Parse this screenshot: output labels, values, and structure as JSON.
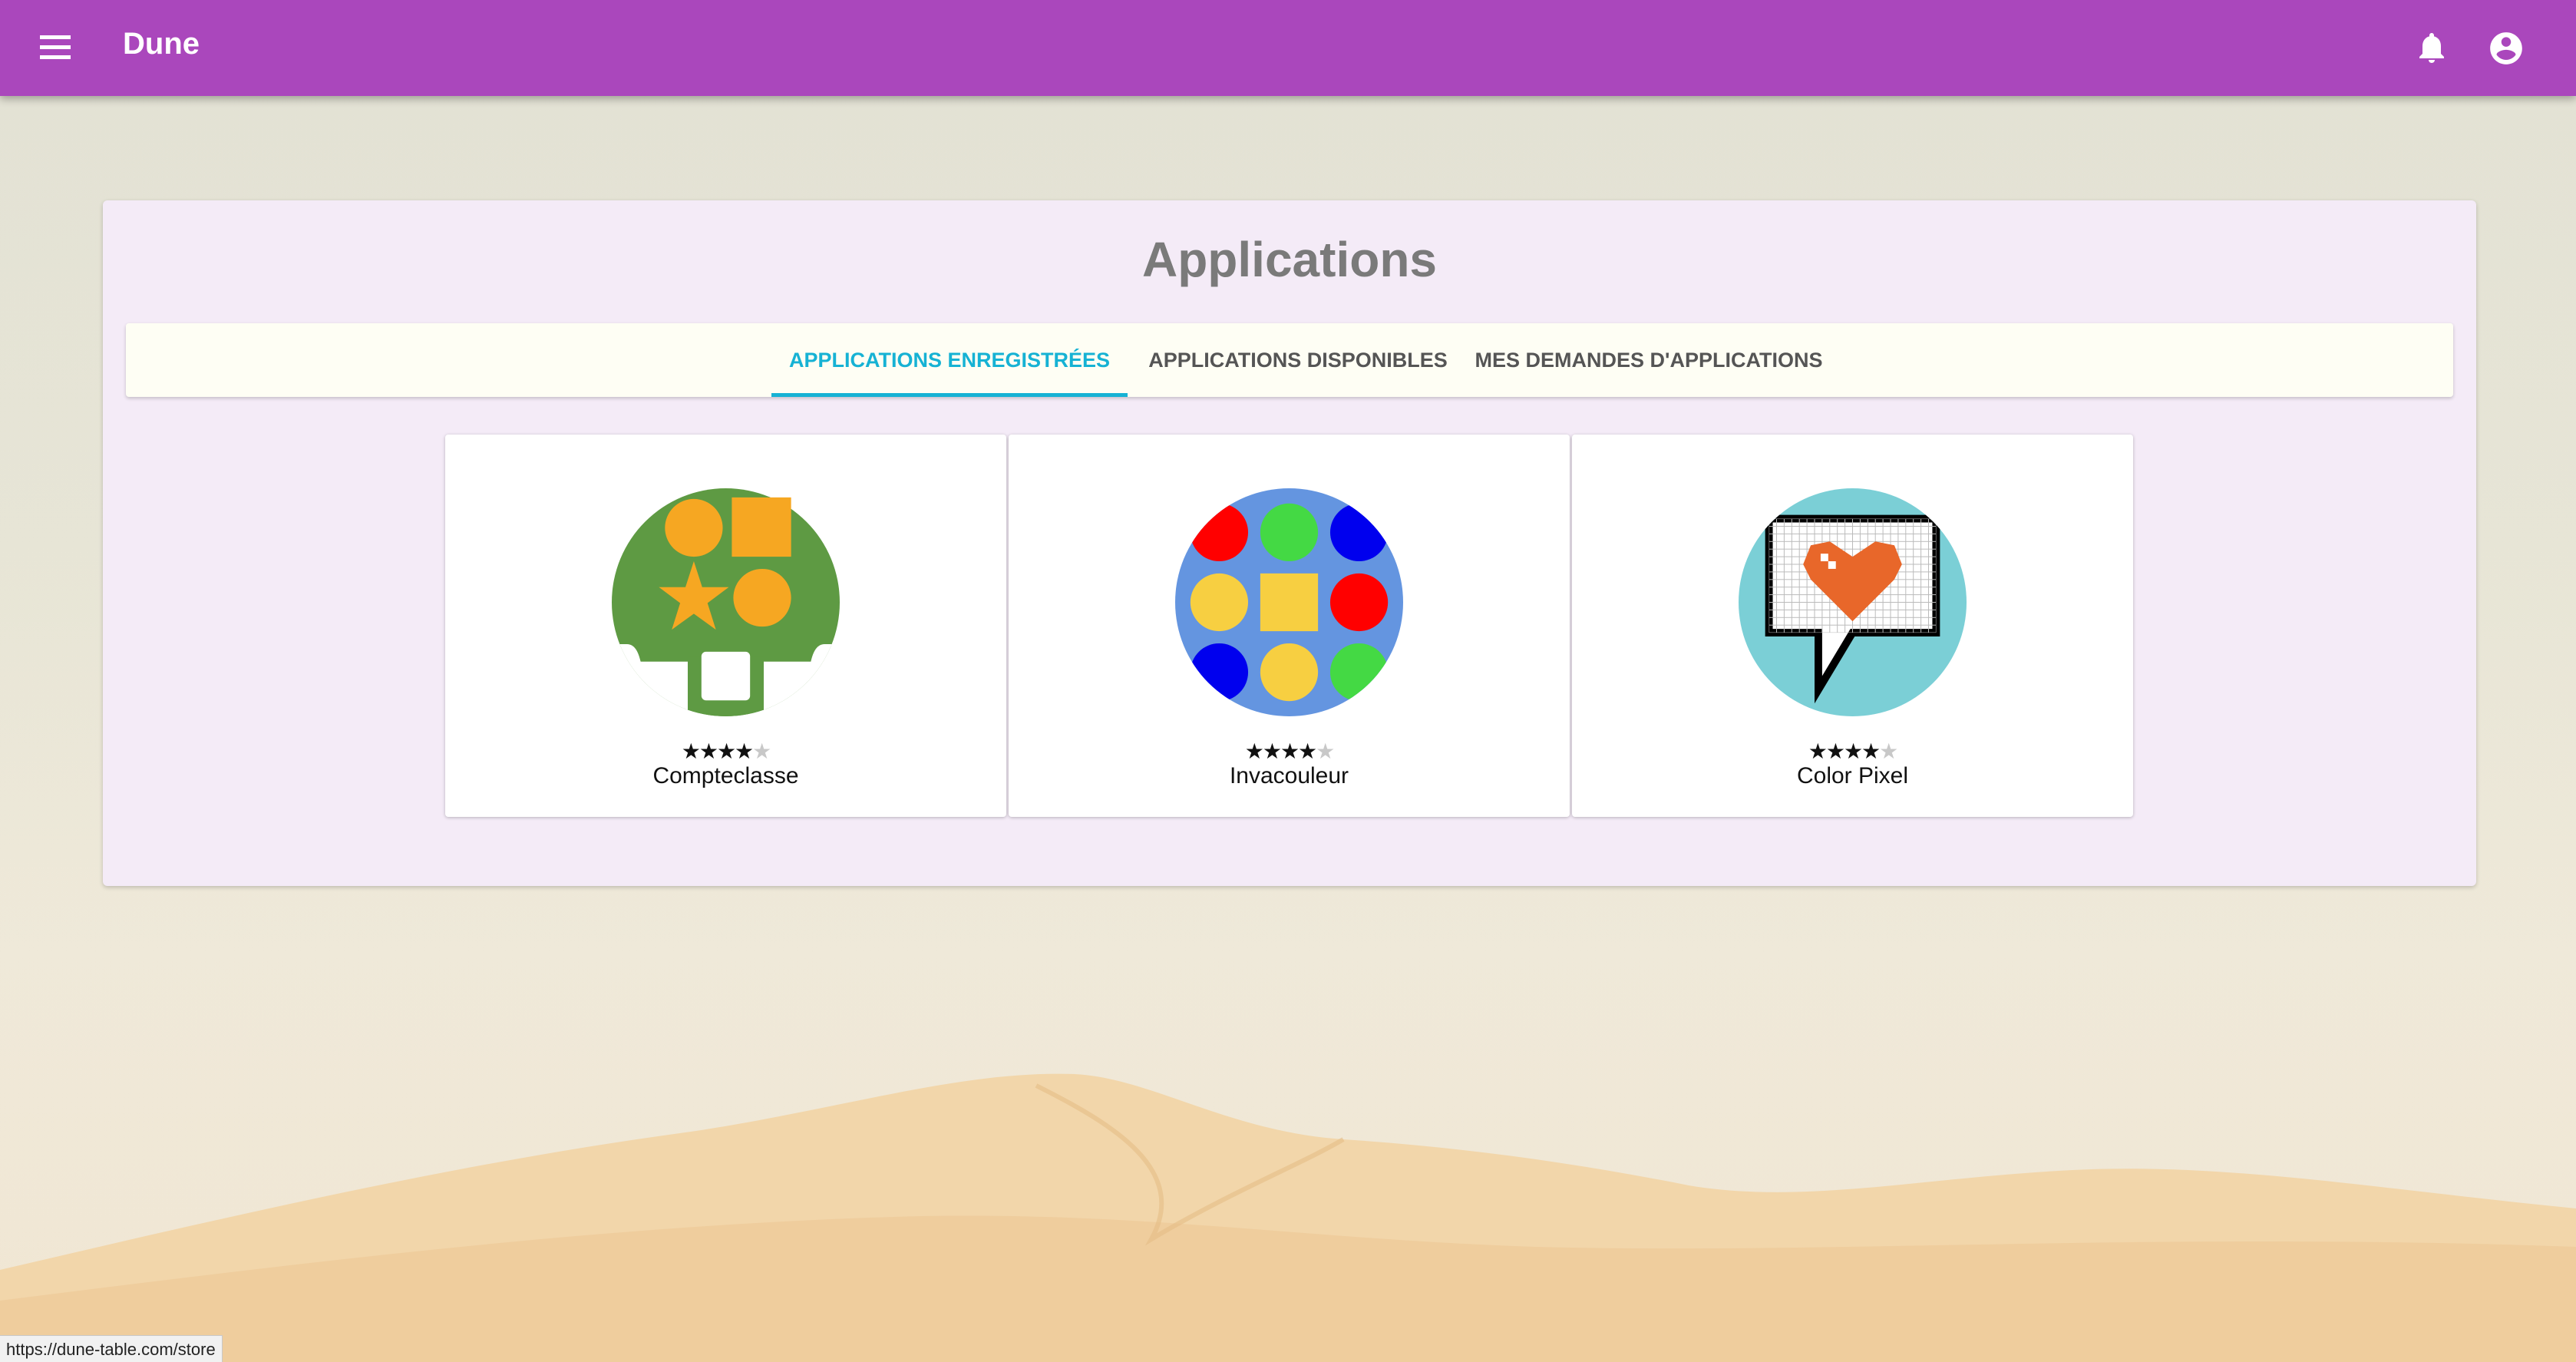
{
  "appbar": {
    "title": "Dune",
    "menu_icon": "menu-icon",
    "notification_icon": "bell-icon",
    "account_icon": "account-circle-icon",
    "color": "#aa47bc"
  },
  "page": {
    "title": "Applications"
  },
  "tabs": [
    {
      "label": "APPLICATIONS ENREGISTRÉES",
      "active": true
    },
    {
      "label": "APPLICATIONS DISPONIBLES",
      "active": false
    },
    {
      "label": "MES DEMANDES D'APPLICATIONS",
      "active": false
    }
  ],
  "apps": [
    {
      "name": "Compteclasse",
      "rating": 4,
      "rating_max": 5,
      "logo_icon": "compteclasse-logo-icon"
    },
    {
      "name": "Invacouleur",
      "rating": 4,
      "rating_max": 5,
      "logo_icon": "invacouleur-logo-icon"
    },
    {
      "name": "Color Pixel",
      "rating": 4,
      "rating_max": 5,
      "logo_icon": "color-pixel-logo-icon"
    }
  ],
  "status_bar": {
    "url": "https://dune-table.com/store"
  },
  "colors": {
    "accent": "#16b2d4",
    "panel": "#f4ebf7"
  }
}
